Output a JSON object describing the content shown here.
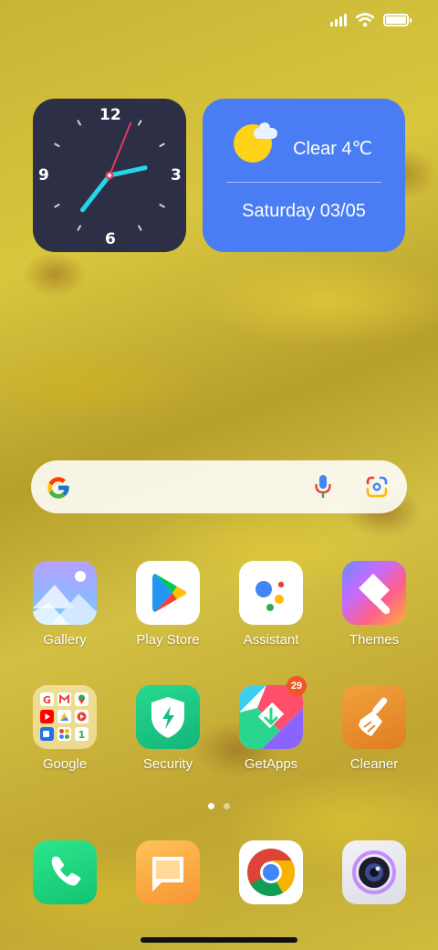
{
  "status_bar": {
    "signal_icon": "signal-bars-icon",
    "wifi_icon": "wifi-icon",
    "battery_icon": "battery-full-icon",
    "battery_level": 1.0
  },
  "clock_widget": {
    "numbers": {
      "twelve": "12",
      "three": "3",
      "six": "6",
      "nine": "9"
    },
    "time": {
      "hour": 7,
      "minute": 12
    },
    "colors": {
      "face": "#2c2f45",
      "hands": "#25d6e6",
      "second_hand": "#e23b5b"
    }
  },
  "weather_widget": {
    "condition_icon": "sun-cloud-icon",
    "condition": "Clear 4℃",
    "date": "Saturday 03/05",
    "color": "#4a7df3"
  },
  "search_bar": {
    "google_icon": "google-g-icon",
    "voice_icon": "microphone-icon",
    "lens_icon": "google-lens-icon"
  },
  "apps_row1": [
    {
      "label": "Gallery",
      "icon": "gallery-icon"
    },
    {
      "label": "Play Store",
      "icon": "play-store-icon"
    },
    {
      "label": "Assistant",
      "icon": "assistant-icon"
    },
    {
      "label": "Themes",
      "icon": "themes-icon"
    }
  ],
  "apps_row2": [
    {
      "label": "Google",
      "icon": "google-folder-icon"
    },
    {
      "label": "Security",
      "icon": "security-icon"
    },
    {
      "label": "GetApps",
      "icon": "getapps-icon",
      "badge": "29"
    },
    {
      "label": "Cleaner",
      "icon": "cleaner-icon"
    }
  ],
  "page_indicator": {
    "pages": 2,
    "current": 1
  },
  "dock": [
    {
      "icon": "phone-icon"
    },
    {
      "icon": "messages-icon"
    },
    {
      "icon": "chrome-icon"
    },
    {
      "icon": "camera-icon"
    }
  ]
}
